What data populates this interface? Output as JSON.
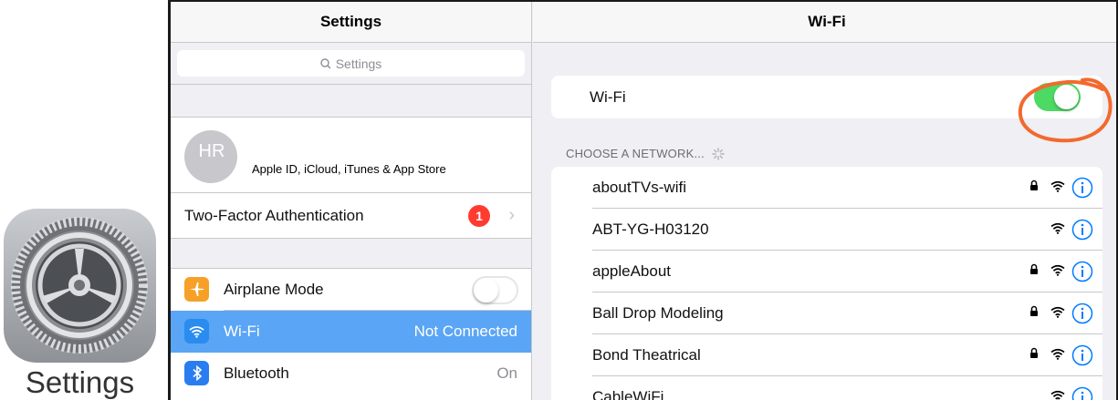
{
  "app_icon": {
    "label": "Settings",
    "icon": "gear-icon"
  },
  "master": {
    "title": "Settings",
    "search_placeholder": "Settings",
    "profile": {
      "initials": "HR",
      "subtitle": "Apple ID, iCloud, iTunes & App Store"
    },
    "two_factor": {
      "label": "Two-Factor Authentication",
      "badge": "1"
    },
    "items": [
      {
        "label": "Airplane Mode",
        "icon": "airplane-icon",
        "icon_color": "#f7a027",
        "value": "",
        "toggle": false
      },
      {
        "label": "Wi-Fi",
        "icon": "wifi-icon",
        "icon_color": "#2a8cf0",
        "value": "Not Connected",
        "selected": true
      },
      {
        "label": "Bluetooth",
        "icon": "bluetooth-icon",
        "icon_color": "#2a7df0",
        "value": "On"
      }
    ]
  },
  "detail": {
    "title": "Wi-Fi",
    "wifi_label": "Wi-Fi",
    "wifi_on": true,
    "section_header": "CHOOSE A NETWORK...",
    "networks": [
      {
        "name": "aboutTVs-wifi",
        "locked": true
      },
      {
        "name": "ABT-YG-H03120",
        "locked": false
      },
      {
        "name": "appleAbout",
        "locked": true
      },
      {
        "name": "Ball Drop Modeling",
        "locked": true
      },
      {
        "name": "Bond Theatrical",
        "locked": true
      },
      {
        "name": "CableWiFi",
        "locked": false
      }
    ]
  },
  "colors": {
    "accent": "#007aff",
    "toggle_on": "#4cd964",
    "selected_row": "#5aa5f5",
    "annotation": "#f26a2e",
    "badge": "#ff3b30"
  }
}
